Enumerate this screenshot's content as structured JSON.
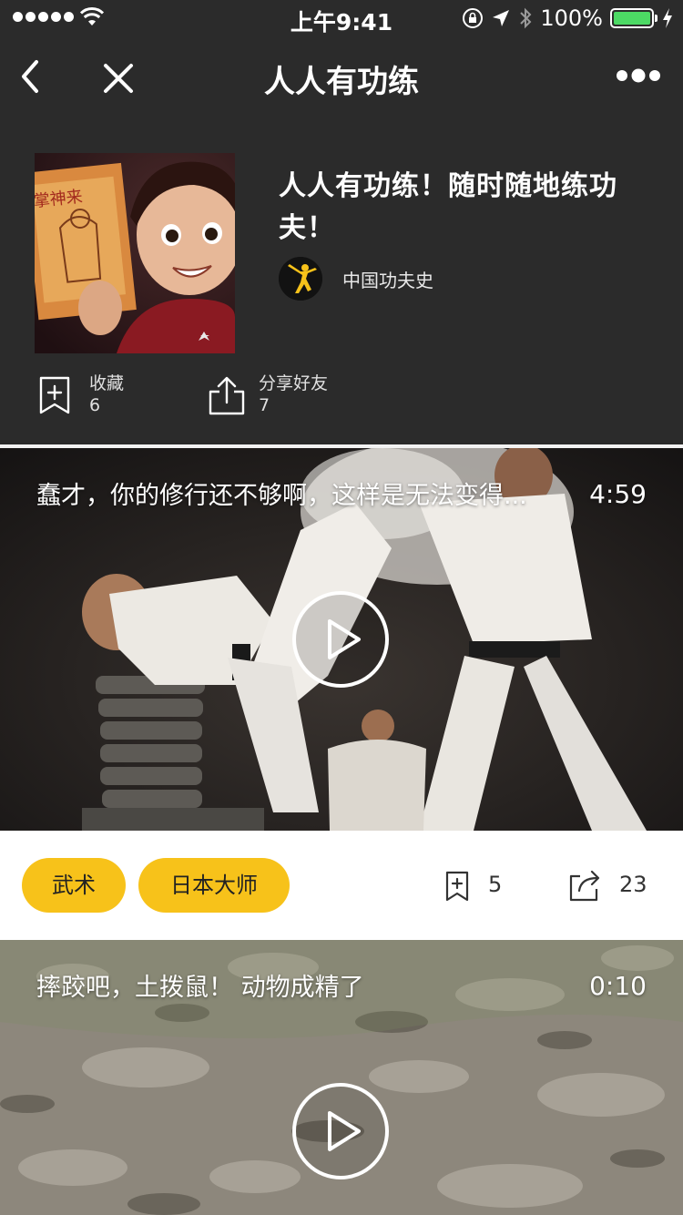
{
  "status_bar": {
    "time": "上午9:41",
    "battery_percent": "100%",
    "battery_level": 1.0,
    "battery_color": "#4cd964"
  },
  "nav": {
    "title": "人人有功练",
    "back_icon": "chevron-left-icon",
    "close_icon": "close-icon",
    "more_icon": "more-icon"
  },
  "album": {
    "title": "人人有功练！随时随地练功夫！",
    "author": "中国功夫史",
    "favorite_label": "收藏",
    "favorite_count": "6",
    "share_label": "分享好友",
    "share_count": "7"
  },
  "videos": [
    {
      "title": "蠢才，你的修行还不够啊，这样是无法变得...",
      "duration": "4:59",
      "tags": [
        "武术",
        "日本大师"
      ],
      "favorite_count": "5",
      "share_count": "23"
    },
    {
      "title": "摔跤吧，土拨鼠！ 动物成精了",
      "duration": "0:10"
    }
  ],
  "colors": {
    "background": "#2b2b2b",
    "tag_accent": "#f7c21a",
    "divider": "#f2f2f2"
  }
}
